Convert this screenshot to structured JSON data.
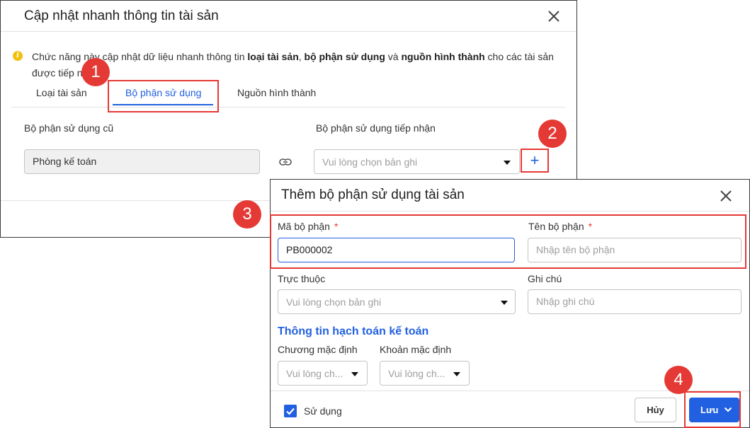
{
  "dialog_main": {
    "title": "Cập nhật nhanh thông tin tài sản",
    "info": {
      "prefix": "Chức năng này cập nhật dữ liệu nhanh thông tin ",
      "b1": "loại tài sản",
      "sep1": ", ",
      "b2": "bộ phận sử dụng",
      "mid": " và ",
      "b3": "nguồn hình thành",
      "suffix": " cho các tài sản được tiếp nhận."
    },
    "tabs": [
      "Loại tài sản",
      "Bộ phận sử dụng",
      "Nguồn hình thành"
    ],
    "active_tab": "Bộ phận sử dụng",
    "old_dept_label": "Bộ phận sử dụng cũ",
    "old_dept_value": "Phòng kế toán",
    "new_dept_label": "Bộ phận sử dụng tiếp nhận",
    "new_dept_placeholder": "Vui lòng chọn bản ghi",
    "add_button": "+"
  },
  "dialog_add": {
    "title": "Thêm bộ phận sử dụng tài sản",
    "code_label": "Mã bộ phận",
    "code_value": "PB000002",
    "name_label": "Tên bộ phận",
    "name_placeholder": "Nhập tên bộ phận",
    "parent_label": "Trực thuộc",
    "parent_placeholder": "Vui lòng chọn bản ghi",
    "note_label": "Ghi chú",
    "note_placeholder": "Nhập ghi chú",
    "accounting_section": "Thông tin hạch toán kế toán",
    "default_program_label": "Chương mặc định",
    "default_program_placeholder": "Vui lòng ch...",
    "default_item_label": "Khoản mặc định",
    "default_item_placeholder": "Vui lòng ch...",
    "required_mark": "*",
    "in_use_label": "Sử dụng",
    "in_use_checked": true,
    "cancel_label": "Hủy",
    "save_label": "Lưu"
  },
  "badges": [
    "1",
    "2",
    "3",
    "4"
  ],
  "colors": {
    "accent": "#2160e0",
    "highlight": "#e53935",
    "info_icon": "#f2c10f"
  }
}
